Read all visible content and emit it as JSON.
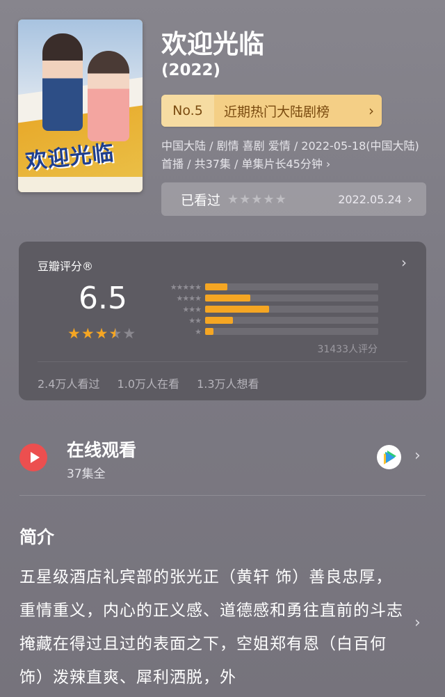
{
  "movie": {
    "poster_title": "欢迎光临",
    "title": "欢迎光临",
    "year": "(2022)",
    "rank": {
      "no": "No.5",
      "label": "近期热门大陆剧榜",
      "chevron": "›"
    },
    "meta": "中国大陆 / 剧情 喜剧 爱情 / 2022-05-18(中国大陆)首播 / 共37集 / 单集片长45分钟 ›",
    "watched": {
      "label": "已看过",
      "stars": "★★★★★",
      "date": "2022.05.24",
      "chevron": "›"
    }
  },
  "rating": {
    "label": "豆瓣评分®",
    "chevron": "›",
    "score": "6.5",
    "stars_value": 3.5,
    "star_glyph": "★",
    "distribution": [
      {
        "stars": "★★★★★",
        "fraction": 0.13
      },
      {
        "stars": "★★★★",
        "fraction": 0.26
      },
      {
        "stars": "★★★",
        "fraction": 0.37
      },
      {
        "stars": "★★",
        "fraction": 0.16
      },
      {
        "stars": "★",
        "fraction": 0.05
      }
    ],
    "count": "31433人评分",
    "stats": [
      "2.4万人看过",
      "1.0万人在看",
      "1.3万人想看"
    ],
    "accent_color": "#f5a623"
  },
  "online": {
    "title": "在线观看",
    "subtitle": "37集全",
    "play_icon": "play-icon",
    "provider_icon": "tencent-video-icon",
    "chevron": "›"
  },
  "intro": {
    "title": "简介",
    "text": "五星级酒店礼宾部的张光正（黄轩 饰）善良忠厚，重情重义，内心的正义感、道德感和勇往直前的斗志掩藏在得过且过的表面之下，空姐郑有恩（白百何 饰）泼辣直爽、犀利洒脱，外",
    "chevron": "›"
  }
}
